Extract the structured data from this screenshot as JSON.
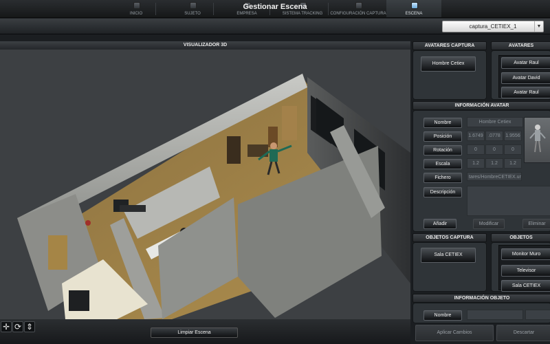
{
  "nav": {
    "items": [
      {
        "label": "INICIO",
        "active": false
      },
      {
        "label": "SUJETO",
        "active": false
      },
      {
        "label": "EMPRESA",
        "active": false
      },
      {
        "label": "SISTEMA TRACKING",
        "active": false
      },
      {
        "label": "CONFIGURACIÓN CAPTURA",
        "active": false
      },
      {
        "label": "ESCENA",
        "active": true
      }
    ]
  },
  "header": {
    "title": "Gestionar Escena",
    "scene_select": {
      "value": "captura_CETIEX_1"
    }
  },
  "viewer": {
    "title": "VISUALIZADOR 3D",
    "clear_label": "Limpiar Escena",
    "tools": [
      {
        "icon": "move-icon",
        "glyph": "✛"
      },
      {
        "icon": "rotate-icon",
        "glyph": "⟳"
      },
      {
        "icon": "arrows-icon",
        "glyph": "⇕"
      }
    ]
  },
  "avatares_captura": {
    "title": "AVATARES CAPTURA",
    "items": [
      "Hombre Cetiex"
    ]
  },
  "avatares": {
    "title": "AVATARES",
    "items": [
      "Avatar Raul",
      "Avatar David",
      "Avatar Raul"
    ]
  },
  "info_avatar": {
    "title": "INFORMACIÓN AVATAR",
    "labels": {
      "nombre": "Nombre",
      "posicion": "Posición",
      "rotacion": "Rotación",
      "escala": "Escala",
      "fichero": "Fichero",
      "descripcion": "Descripción"
    },
    "values": {
      "nombre": "Hombre Cetiex",
      "posicion": [
        "1.6749",
        ".0778",
        "1.9556"
      ],
      "rotacion": [
        "0",
        "0",
        "0"
      ],
      "escala": [
        "1.2",
        "1.2",
        "1.2"
      ],
      "fichero": "tares/HombreCETIEX.uni"
    },
    "actions": {
      "add": "Añadir",
      "modify": "Modificar",
      "delete": "Eliminar"
    }
  },
  "objetos_captura": {
    "title": "OBJETOS CAPTURA",
    "items": [
      "Sala CETIEX"
    ]
  },
  "objetos": {
    "title": "OBJETOS",
    "items": [
      "Monitor Muro",
      "Televisor",
      "Sala CETIEX"
    ]
  },
  "info_objeto": {
    "title": "INFORMACIÓN OBJETO",
    "labels": {
      "nombre": "Nombre"
    }
  },
  "footer": {
    "apply": "Aplicar Cambios",
    "discard": "Descartar"
  }
}
